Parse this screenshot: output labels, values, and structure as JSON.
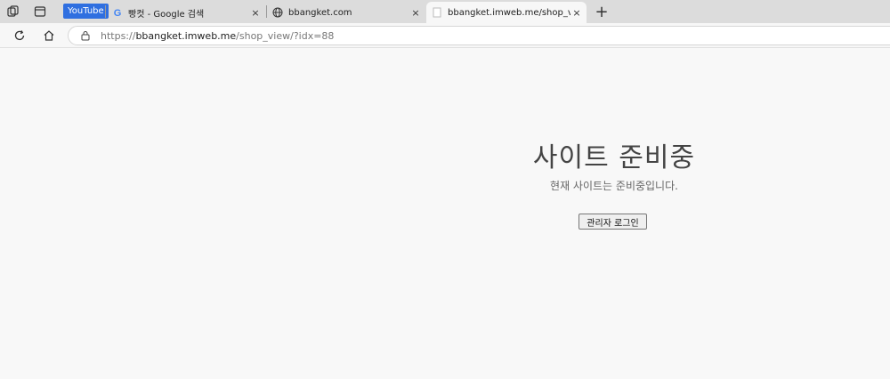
{
  "tabs": [
    {
      "badge": "YouTube"
    },
    {
      "title": "빵컷 - Google 검색",
      "close": "×"
    },
    {
      "title": "bbangket.com",
      "close": "×"
    },
    {
      "title": "bbangket.imweb.me/shop_view/?i",
      "close": "×"
    }
  ],
  "new_tab_label": "+",
  "address": {
    "host_prefix": "https://",
    "host": "bbangket.imweb.me",
    "path": "/shop_view/?idx=88"
  },
  "page": {
    "heading": "사이트 준비중",
    "subtitle": "현재 사이트는 준비중입니다.",
    "login_button": "관리자 로그인"
  },
  "colors": {
    "accent": "#2f6fe0",
    "background": "#f8f8f8"
  }
}
